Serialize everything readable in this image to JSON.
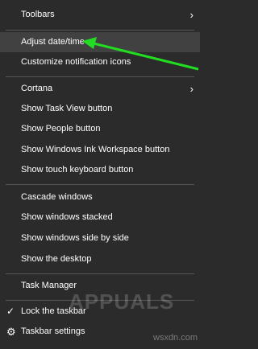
{
  "menu": {
    "toolbars": "Toolbars",
    "adjust_datetime": "Adjust date/time",
    "customize_notification_icons": "Customize notification icons",
    "cortana": "Cortana",
    "show_task_view_button": "Show Task View button",
    "show_people_button": "Show People button",
    "show_ink_workspace_button": "Show Windows Ink Workspace button",
    "show_touch_keyboard_button": "Show touch keyboard button",
    "cascade_windows": "Cascade windows",
    "show_windows_stacked": "Show windows stacked",
    "show_windows_side_by_side": "Show windows side by side",
    "show_the_desktop": "Show the desktop",
    "task_manager": "Task Manager",
    "lock_the_taskbar": "Lock the taskbar",
    "taskbar_settings": "Taskbar settings"
  },
  "icons": {
    "submenu_arrow": "›",
    "checkmark": "✓",
    "settings": "⚙"
  },
  "watermark": {
    "brand": "APPUALS",
    "site": "wsxdn.com"
  },
  "colors": {
    "menu_bg": "#2b2b2b",
    "hover_bg": "#414141",
    "separator": "#555555",
    "pointer_arrow": "#22dd22"
  }
}
